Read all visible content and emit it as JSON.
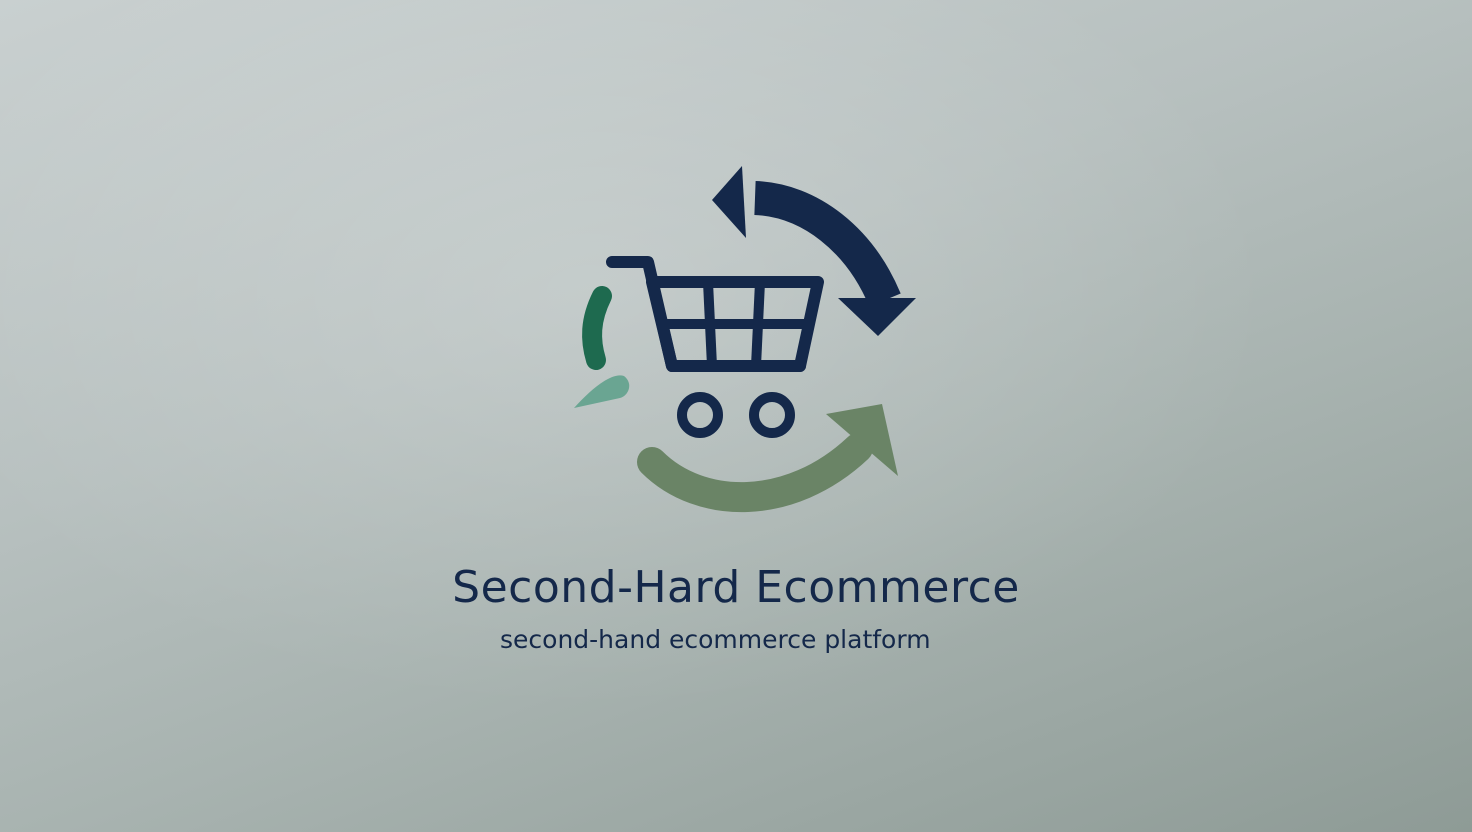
{
  "brand": {
    "name": "Second-Hard Ecommerce",
    "tagline": "second-hand ecommerce platform"
  },
  "logo": {
    "icons": [
      "shopping-cart-icon",
      "recycle-arrow-icon"
    ],
    "colors": {
      "navy": "#14284a",
      "dark_green": "#1e6a4f",
      "sage_green": "#6a8466",
      "teal_green": "#6aa592"
    }
  },
  "background": {
    "gradient_start": "#c9d0d0",
    "gradient_end": "#8e9b96"
  }
}
